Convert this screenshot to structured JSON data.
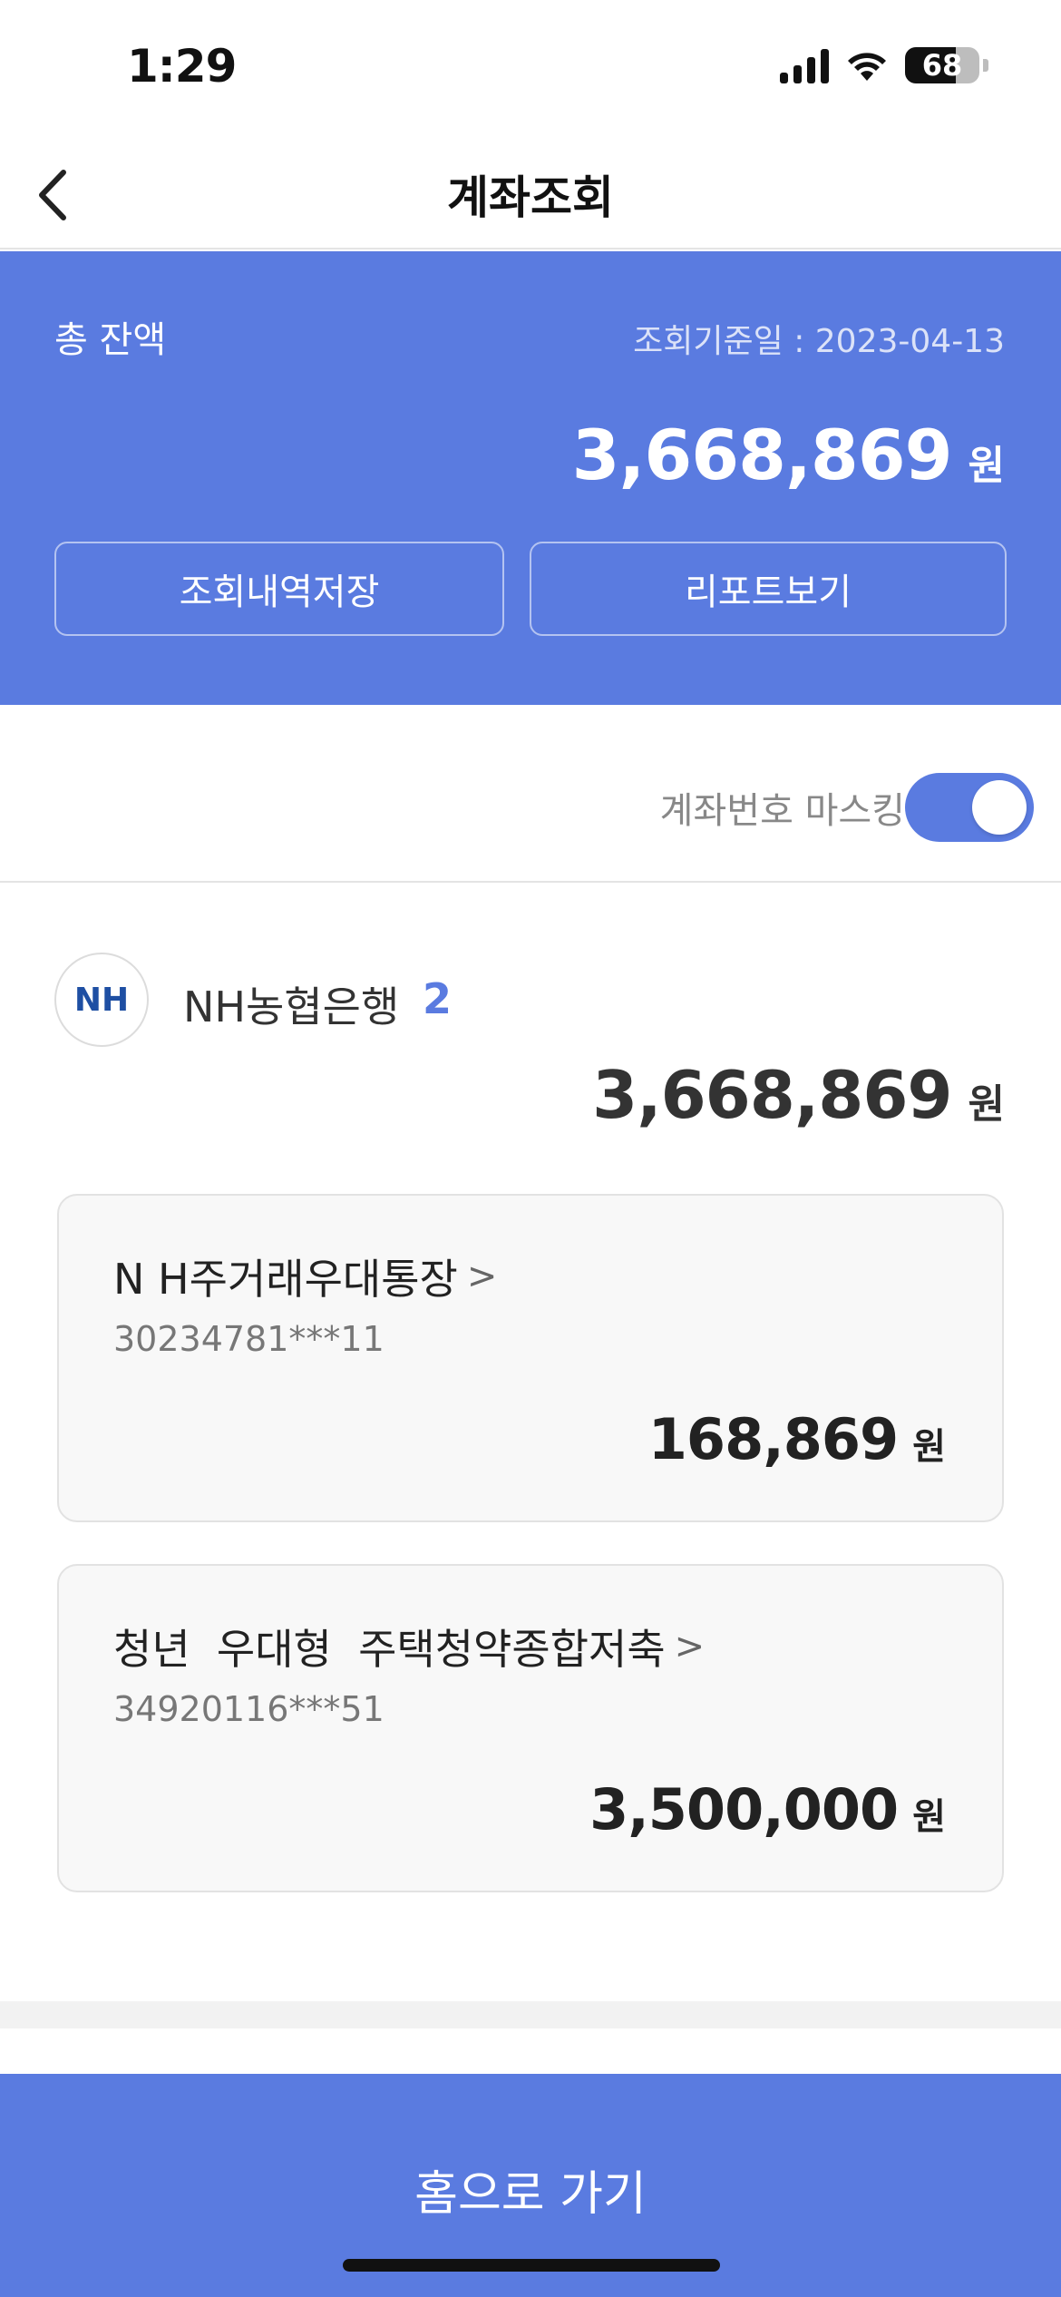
{
  "status_bar": {
    "time": "1:29",
    "battery": "68",
    "battery_level_percent": 68,
    "signal_icon": "cellular-signal-icon",
    "wifi_icon": "wifi-icon"
  },
  "nav": {
    "title": "계좌조회",
    "back_icon": "chevron-left-icon"
  },
  "summary": {
    "label": "총 잔액",
    "date": "조회기준일 : 2023-04-13",
    "amount": "3,668,869",
    "unit": "원",
    "save_button": "조회내역저장",
    "report_button": "리포트보기"
  },
  "masking": {
    "label": "계좌번호 마스킹",
    "enabled": true
  },
  "bank": {
    "logo_text": "NH",
    "name": "NH농협은행",
    "count": "2",
    "total": "3,668,869",
    "unit": "원"
  },
  "accounts": [
    {
      "name": "N H주거래우대통장",
      "chevron": ">",
      "number": "30234781***11",
      "balance": "168,869",
      "unit": "원"
    },
    {
      "name": "청년  우대형  주택청약종합저축",
      "chevron": ">",
      "number": "34920116***51",
      "balance": "3,500,000",
      "unit": "원"
    }
  ],
  "footer": {
    "home_button": "홈으로 가기"
  },
  "colors": {
    "accent": "#5a7be0",
    "bank_logo": "#1e4fa3"
  }
}
